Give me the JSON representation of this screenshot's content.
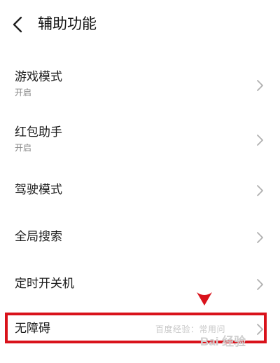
{
  "header": {
    "title": "辅助功能"
  },
  "items": [
    {
      "label": "游戏模式",
      "sub": "开启"
    },
    {
      "label": "红包助手",
      "sub": "开启"
    },
    {
      "label": "驾驶模式"
    },
    {
      "label": "全局搜索"
    },
    {
      "label": "定时开关机"
    },
    {
      "label": "无障碍"
    }
  ],
  "watermark": {
    "text": "百度经验：常用问",
    "logo": "Bai 经验"
  },
  "colors": {
    "highlight": "#d9121b",
    "chevron": "#b0b0b0",
    "subtext": "#888888"
  }
}
